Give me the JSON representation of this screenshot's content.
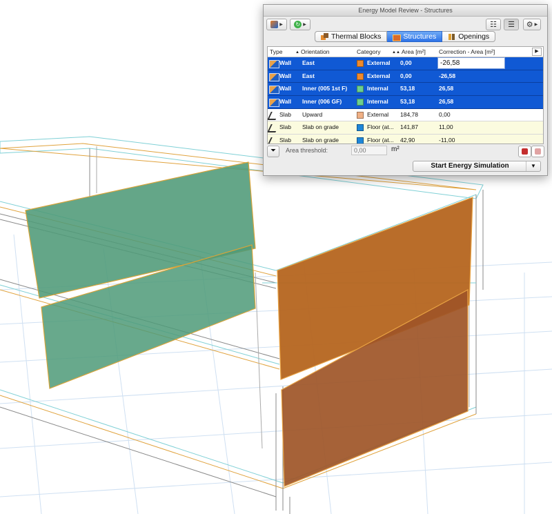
{
  "window": {
    "title": "Energy Model Review - Structures"
  },
  "toolbar": {
    "left_icons": [
      "model-review-icon",
      "sync-icon"
    ],
    "right_icons": [
      "list-detail-icon",
      "list-icon",
      "gear-icon"
    ]
  },
  "tabs": [
    {
      "label": "Thermal Blocks",
      "icon": "thermal-blocks-icon",
      "active": false
    },
    {
      "label": "Structures",
      "icon": "structures-icon",
      "active": true
    },
    {
      "label": "Openings",
      "icon": "openings-icon",
      "active": false
    }
  ],
  "table": {
    "columns": [
      "Type",
      "Orientation",
      "Category",
      "Area [m²]",
      "Correction - Area [m²]"
    ],
    "rows": [
      {
        "type": "Wall",
        "orientation": "East",
        "category": "External",
        "area": "0,00",
        "correction": "-26,58",
        "color": "#f08a2c",
        "state": "editing"
      },
      {
        "type": "Wall",
        "orientation": "East",
        "category": "External",
        "area": "0,00",
        "correction": "-26,58",
        "color": "#f08a2c",
        "state": "selected"
      },
      {
        "type": "Wall",
        "orientation": "Inner (005 1st F)",
        "category": "Internal",
        "area": "53,18",
        "correction": "26,58",
        "color": "#6ccf8d",
        "state": "selected"
      },
      {
        "type": "Wall",
        "orientation": "Inner (006 GF)",
        "category": "Internal",
        "area": "53,18",
        "correction": "26,58",
        "color": "#6ccf8d",
        "state": "selected"
      },
      {
        "type": "Slab",
        "orientation": "Upward",
        "category": "External",
        "area": "184,78",
        "correction": "0,00",
        "color": "#f0b085",
        "state": "plain"
      },
      {
        "type": "Slab",
        "orientation": "Slab on grade",
        "category": "Floor (at...",
        "area": "141,87",
        "correction": "11,00",
        "color": "#1e86d8",
        "state": "highlight"
      },
      {
        "type": "Slab",
        "orientation": "Slab on grade",
        "category": "Floor (at...",
        "area": "42,90",
        "correction": "-11,00",
        "color": "#1e86d8",
        "state": "highlight"
      }
    ]
  },
  "filter": {
    "label": "Area threshold:",
    "placeholder": "0,00",
    "unit": "m²"
  },
  "simulation": {
    "button_label": "Start Energy Simulation"
  },
  "colors": {
    "selection": "#1059d4",
    "external_wall": "#b5651f",
    "internal_wall": "#4e9a78",
    "highlight_row": "#fbfbdf"
  }
}
